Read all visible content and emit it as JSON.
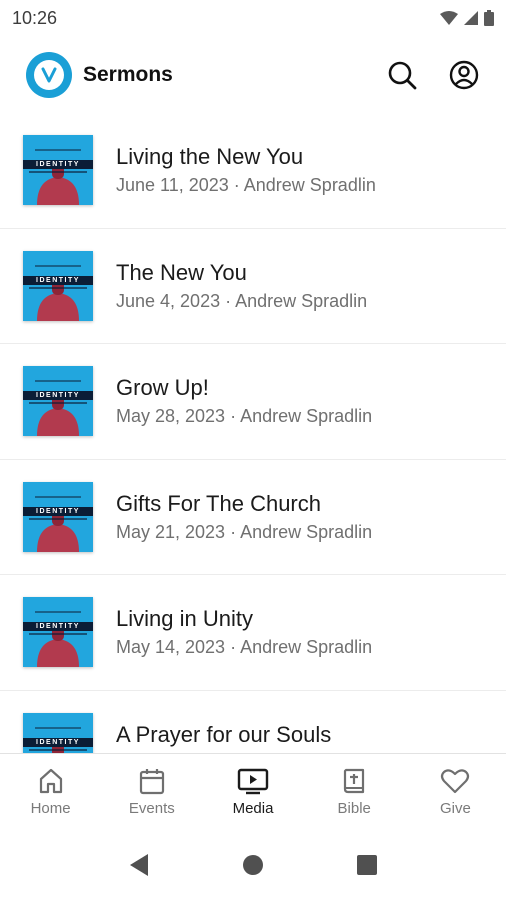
{
  "status": {
    "time": "10:26"
  },
  "header": {
    "title": "Sermons"
  },
  "sermons": [
    {
      "title": "Living the New You",
      "subtitle": "June 11, 2023 · Andrew Spradlin",
      "thumb_text": "IDENTITY"
    },
    {
      "title": "The New You",
      "subtitle": "June 4, 2023 · Andrew Spradlin",
      "thumb_text": "IDENTITY"
    },
    {
      "title": "Grow Up!",
      "subtitle": "May 28, 2023 · Andrew Spradlin",
      "thumb_text": "IDENTITY"
    },
    {
      "title": "Gifts For The Church",
      "subtitle": "May 21, 2023 · Andrew Spradlin",
      "thumb_text": "IDENTITY"
    },
    {
      "title": "Living in Unity",
      "subtitle": "May 14, 2023 · Andrew Spradlin",
      "thumb_text": "IDENTITY"
    },
    {
      "title": "A Prayer for our Souls",
      "subtitle": "",
      "thumb_text": "IDENTITY"
    }
  ],
  "nav": {
    "items": [
      {
        "label": "Home",
        "icon": "home-icon"
      },
      {
        "label": "Events",
        "icon": "calendar-icon"
      },
      {
        "label": "Media",
        "icon": "media-icon",
        "active": true
      },
      {
        "label": "Bible",
        "icon": "bible-icon"
      },
      {
        "label": "Give",
        "icon": "heart-icon"
      }
    ]
  },
  "colors": {
    "brand": "#1a9fd6",
    "thumb_bg": "#22a6de",
    "figure": "#b23a4e"
  }
}
